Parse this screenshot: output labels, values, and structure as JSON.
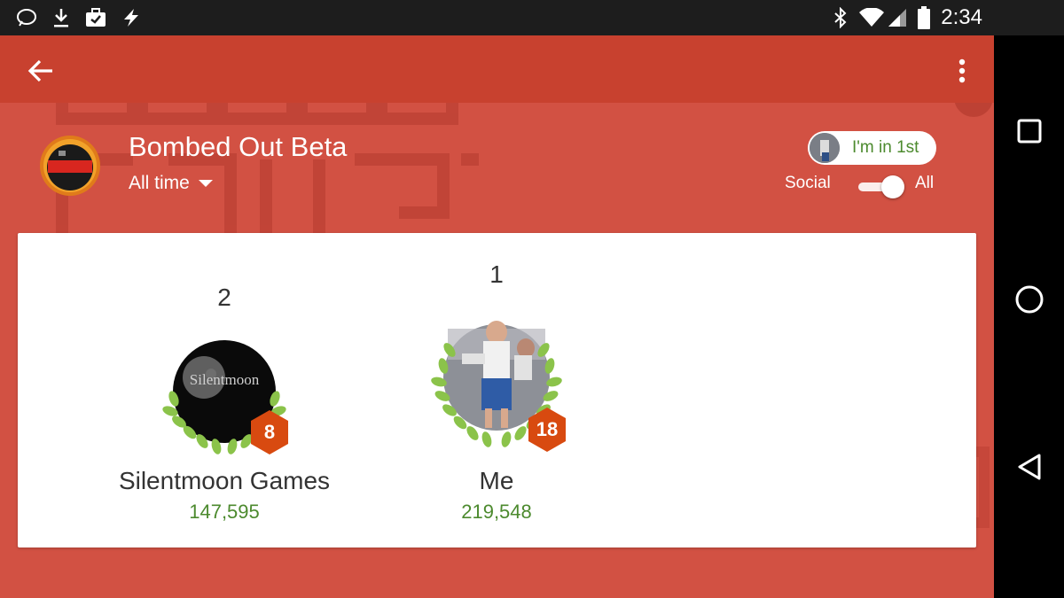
{
  "status_bar": {
    "time": "2:34",
    "left_icons": [
      "chat-bubble-icon",
      "download-icon",
      "briefcase-check-icon",
      "flash-icon"
    ],
    "right_icons": [
      "bluetooth-icon",
      "wifi-icon",
      "signal-icon",
      "battery-icon"
    ]
  },
  "toolbar": {
    "back_icon": "arrow-back-icon",
    "menu_icon": "more-vertical-icon"
  },
  "header": {
    "game_title": "Bombed Out Beta",
    "time_filter": "All time"
  },
  "rank_chip": {
    "label": "I'm in 1st"
  },
  "scope_toggle": {
    "left_label": "Social",
    "right_label": "All",
    "selected": "All"
  },
  "leaderboard": [
    {
      "rank": "2",
      "name": "Silentmoon Games",
      "score": "147,595",
      "level": "8",
      "avatar_text": "Silentmoon"
    },
    {
      "rank": "1",
      "name": "Me",
      "score": "219,548",
      "level": "18"
    }
  ],
  "nav_bar": {
    "icons": [
      "recents-square-icon",
      "home-circle-icon",
      "back-triangle-icon"
    ]
  },
  "colors": {
    "app_background": "#d25143",
    "toolbar": "#c8412f",
    "score_green": "#4c8a2e",
    "laurel_green": "#8bc34a",
    "badge_orange": "#d84a10"
  }
}
